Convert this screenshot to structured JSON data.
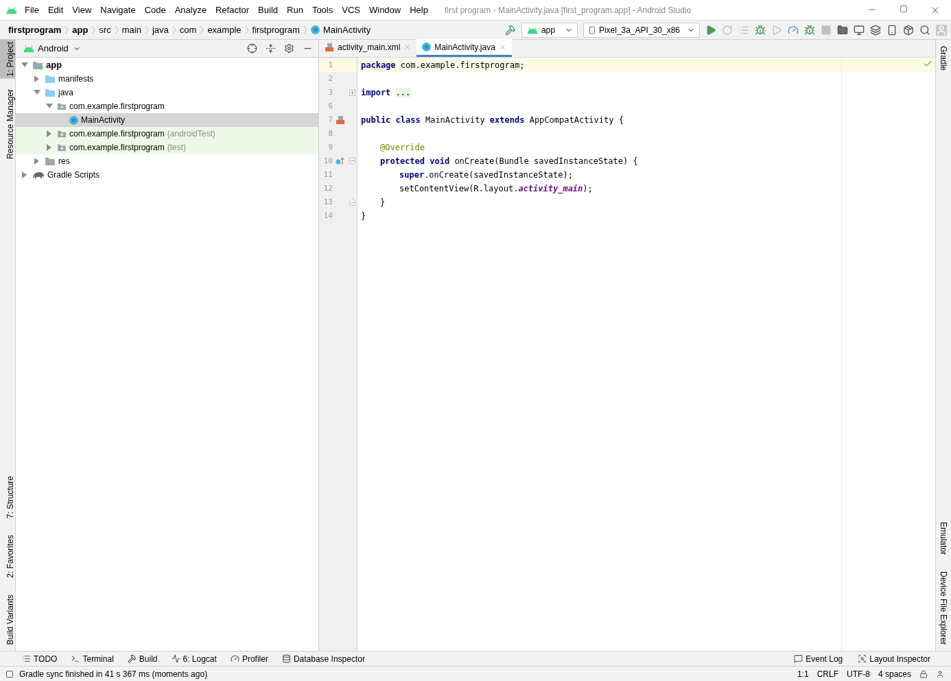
{
  "window": {
    "title": "first program - MainActivity.java [first_program.app] - Android Studio"
  },
  "menu": [
    "File",
    "Edit",
    "View",
    "Navigate",
    "Code",
    "Analyze",
    "Refactor",
    "Build",
    "Run",
    "Tools",
    "VCS",
    "Window",
    "Help"
  ],
  "breadcrumbs": [
    {
      "label": "firstprogram",
      "bold": true
    },
    {
      "label": "app",
      "bold": true
    },
    {
      "label": "src",
      "bold": false
    },
    {
      "label": "main",
      "bold": false
    },
    {
      "label": "java",
      "bold": false
    },
    {
      "label": "com",
      "bold": false
    },
    {
      "label": "example",
      "bold": false
    },
    {
      "label": "firstprogram",
      "bold": false
    },
    {
      "label": "MainActivity",
      "bold": false,
      "kind": "class"
    }
  ],
  "run_config": "app",
  "device": "Pixel_3a_API_30_x86",
  "left_tool_tabs": {
    "top": [
      {
        "label": "1: Project",
        "selected": true
      },
      {
        "label": "Resource Manager",
        "selected": false
      }
    ],
    "bottom": [
      {
        "label": "7: Structure",
        "selected": false
      },
      {
        "label": "2: Favorites",
        "selected": false
      },
      {
        "label": "Build Variants",
        "selected": false
      }
    ]
  },
  "right_tool_tabs": {
    "top": [
      {
        "label": "Gradle"
      }
    ],
    "bottom": [
      {
        "label": "Emulator"
      },
      {
        "label": "Device File Explorer"
      }
    ]
  },
  "project": {
    "view": "Android",
    "tree": [
      {
        "label": "app",
        "kind": "module",
        "expanded": true,
        "selected": false,
        "highlighted": false,
        "children": [
          {
            "label": "manifests",
            "kind": "folder",
            "expanded": false,
            "selected": false,
            "highlighted": false
          },
          {
            "label": "java",
            "kind": "folder",
            "expanded": true,
            "selected": false,
            "highlighted": false,
            "children": [
              {
                "label": "com.example.firstprogram",
                "kind": "package",
                "expanded": true,
                "selected": false,
                "highlighted": false,
                "children": [
                  {
                    "label": "MainActivity",
                    "kind": "class",
                    "selected": true
                  }
                ]
              },
              {
                "label": "com.example.firstprogram",
                "suffix": "(androidTest)",
                "kind": "package",
                "expanded": false,
                "selected": false,
                "highlighted": true
              },
              {
                "label": "com.example.firstprogram",
                "suffix": "(test)",
                "kind": "package",
                "expanded": false,
                "selected": false,
                "highlighted": true
              }
            ]
          },
          {
            "label": "res",
            "kind": "res",
            "expanded": false,
            "selected": false,
            "highlighted": false
          }
        ]
      },
      {
        "label": "Gradle Scripts",
        "kind": "gradle",
        "expanded": false,
        "selected": false,
        "highlighted": false
      }
    ]
  },
  "editor_tabs": [
    {
      "label": "activity_main.xml",
      "kind": "xml",
      "selected": false
    },
    {
      "label": "MainActivity.java",
      "kind": "class",
      "selected": true
    }
  ],
  "code": [
    {
      "number": "1",
      "current": true,
      "kind": "top",
      "tokens": [
        {
          "kind": "keyword",
          "text": "package"
        },
        {
          "kind": "plain",
          "text": " com.example.firstprogram;"
        }
      ]
    },
    {
      "number": "2",
      "current": false,
      "kind": "top"
    },
    {
      "number": "3",
      "current": false,
      "kind": "top",
      "fold_marker": {
        "kind": "collapsed"
      },
      "tokens": [
        {
          "kind": "keyword",
          "text": "import"
        },
        {
          "kind": "folded",
          "text": "..."
        }
      ]
    },
    {
      "number": "6",
      "current": false,
      "kind": "top"
    },
    {
      "number": "7",
      "current": false,
      "kind": "top",
      "gutter_icon": {
        "kind": "layout"
      },
      "tokens": [
        {
          "kind": "keyword",
          "text": "public class"
        },
        {
          "kind": "plain",
          "text": " MainActivity "
        },
        {
          "kind": "keyword",
          "text": "extends"
        },
        {
          "kind": "plain",
          "text": " AppCompatActivity {"
        }
      ]
    },
    {
      "number": "8",
      "current": false,
      "kind": "top"
    },
    {
      "number": "9",
      "current": false,
      "kind": "member",
      "tokens": [
        {
          "kind": "annotation",
          "text": "@Override"
        }
      ]
    },
    {
      "number": "10",
      "current": false,
      "kind": "member",
      "gutter_icon": {
        "kind": "override"
      },
      "fold_marker": {
        "kind": "open"
      },
      "tokens": [
        {
          "kind": "keyword",
          "text": "protected void"
        },
        {
          "kind": "plain",
          "text": " onCreate(Bundle savedInstanceState) {"
        }
      ]
    },
    {
      "number": "11",
      "current": false,
      "kind": "body",
      "tokens": [
        {
          "kind": "keyword",
          "text": "super"
        },
        {
          "kind": "plain",
          "text": ".onCreate(savedInstanceState);"
        }
      ]
    },
    {
      "number": "12",
      "current": false,
      "kind": "body",
      "tokens": [
        {
          "kind": "plain",
          "text": "setContentView(R.layout."
        },
        {
          "kind": "field",
          "text": "activity_main"
        },
        {
          "kind": "plain",
          "text": ");"
        }
      ]
    },
    {
      "number": "13",
      "current": false,
      "kind": "member",
      "fold_marker": {
        "kind": "close"
      },
      "tokens": [
        {
          "kind": "plain",
          "text": "}"
        }
      ]
    },
    {
      "number": "14",
      "current": false,
      "tokens": [
        {
          "kind": "plain",
          "text": "}"
        }
      ]
    }
  ],
  "bottom_tools": {
    "left": [
      {
        "label": "TODO",
        "kind": "list"
      },
      {
        "label": "Terminal",
        "kind": "terminal"
      },
      {
        "label": "Build",
        "kind": "hammer"
      },
      {
        "label": "6: Logcat",
        "kind": "logcat"
      },
      {
        "label": "Profiler",
        "kind": "gauge"
      },
      {
        "label": "Database Inspector",
        "kind": "database"
      }
    ],
    "right": [
      {
        "label": "Event Log",
        "kind": "bubble"
      },
      {
        "label": "Layout Inspector",
        "kind": "inspect"
      }
    ]
  },
  "status_bar": {
    "message": "Gradle sync finished in 41 s 367 ms (moments ago)",
    "position": "1:1",
    "line_separator": "CRLF",
    "encoding": "UTF-8",
    "indent": "4 spaces"
  }
}
